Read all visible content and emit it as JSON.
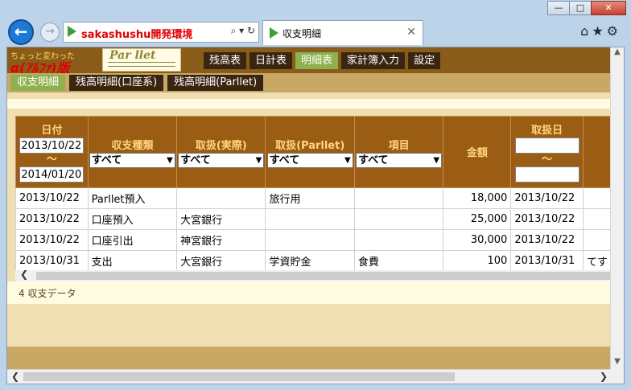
{
  "window": {
    "minimize_glyph": "—",
    "maximize_glyph": "□",
    "close_glyph": "✕"
  },
  "browser": {
    "address_text": "sakashushu開発環境",
    "address_icons": "⌕ ▾ ↻",
    "tab_title": "収支明細",
    "tab_close": "✕",
    "nav_icons": "⌂★⚙"
  },
  "site": {
    "logo_line1": "ちょっと変わった",
    "logo_line2": "α(ｱﾙﾌｧ)版",
    "logo2_text": "Par llet",
    "main_nav": [
      {
        "label": "残高表",
        "active": false
      },
      {
        "label": "日計表",
        "active": false
      },
      {
        "label": "明細表",
        "active": true
      },
      {
        "label": "家計簿入力",
        "active": false
      },
      {
        "label": "設定",
        "active": false
      }
    ],
    "sub_nav": [
      {
        "label": "収支明細",
        "active": true
      },
      {
        "label": "残高明細(口座系)",
        "active": false
      },
      {
        "label": "残高明細(Parllet)",
        "active": false
      }
    ]
  },
  "table": {
    "headers": {
      "date": "日付",
      "type": "収支種類",
      "handling_actual": "取扱(実際)",
      "handling_parllet": "取扱(Parllet)",
      "item": "項目",
      "amount": "金額",
      "handling_date": "取扱日"
    },
    "filters": {
      "date_from": "2013/10/22",
      "date_to": "2014/01/20",
      "tilde": "～",
      "type": "すべて",
      "handling_actual": "すべて",
      "handling_parllet": "すべて",
      "item": "すべて",
      "handling_date_from": "",
      "handling_date_to": ""
    },
    "rows": [
      {
        "date": "2013/10/22",
        "type": "Parllet預入",
        "actual": "",
        "parllet": "旅行用",
        "item": "",
        "amount": "18,000",
        "handling_date": "2013/10/22",
        "extra": ""
      },
      {
        "date": "2013/10/22",
        "type": "口座預入",
        "actual": "大宮銀行",
        "parllet": "",
        "item": "",
        "amount": "25,000",
        "handling_date": "2013/10/22",
        "extra": ""
      },
      {
        "date": "2013/10/22",
        "type": "口座引出",
        "actual": "神宮銀行",
        "parllet": "",
        "item": "",
        "amount": "30,000",
        "handling_date": "2013/10/22",
        "extra": ""
      },
      {
        "date": "2013/10/31",
        "type": "支出",
        "actual": "大宮銀行",
        "parllet": "学資貯金",
        "item": "食費",
        "amount": "100",
        "handling_date": "2013/10/31",
        "extra": "てす"
      }
    ]
  },
  "footer": {
    "count_text": "4 収支データ"
  },
  "scrollbars": {
    "left": "❮",
    "right": "❯",
    "up": "▲",
    "down": "▼"
  }
}
